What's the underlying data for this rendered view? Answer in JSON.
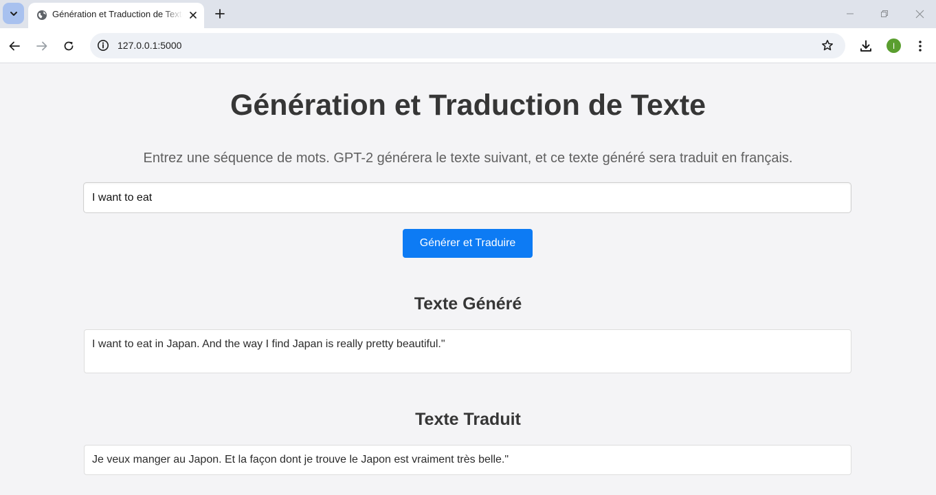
{
  "browser": {
    "tab": {
      "title": "Génération et Traduction de Texte",
      "favicon": "globe-icon"
    },
    "address_bar": {
      "url": "127.0.0.1:5000"
    },
    "profile_initial": "I",
    "colors": {
      "profile_avatar": "#5a9e2f",
      "tab_strip": "#dfe3eb"
    }
  },
  "page": {
    "title": "Génération et Traduction de Texte",
    "instruction": "Entrez une séquence de mots. GPT-2 générera le texte suivant, et ce texte généré sera traduit en français.",
    "input": {
      "value": "I want to eat"
    },
    "submit_label": "Générer et Traduire",
    "generated": {
      "heading": "Texte Généré",
      "text": "I want to eat in Japan. And the way I find Japan is really pretty beautiful.\""
    },
    "translated": {
      "heading": "Texte Traduit",
      "text": "Je veux manger au Japon. Et la façon dont je trouve le Japon est vraiment très belle.\""
    },
    "colors": {
      "button": "#0d7bf4",
      "background": "#f4f4f6",
      "heading_text": "#363636"
    }
  }
}
